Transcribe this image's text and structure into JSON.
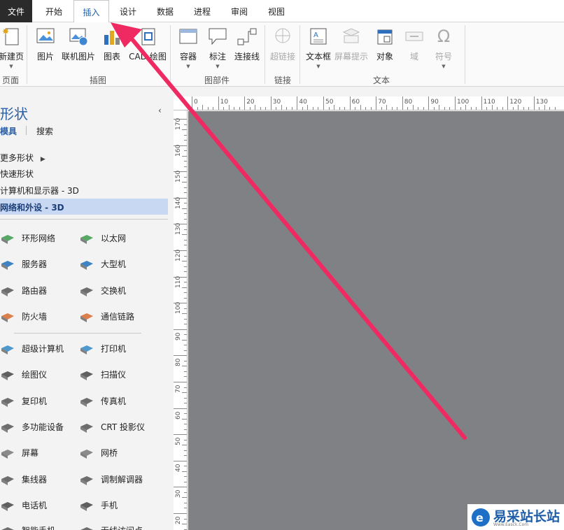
{
  "tabs": {
    "file": "文件",
    "home": "开始",
    "insert": "插入",
    "design": "设计",
    "data": "数据",
    "process": "进程",
    "review": "审阅",
    "view": "视图"
  },
  "ribbon": {
    "new_page": "新建页",
    "picture": "图片",
    "online_picture": "联机图片",
    "chart": "图表",
    "cad_drawing": "CAD 绘图",
    "container": "容器",
    "callout": "标注",
    "connector": "连接线",
    "hyperlink": "超链接",
    "screentip": "屏幕提示",
    "textbox": "文本框",
    "object": "对象",
    "field": "域",
    "symbol": "符号",
    "groups": {
      "pages": "页面",
      "illustrations": "插图",
      "diagram_parts": "图部件",
      "links": "链接",
      "text": "文本"
    }
  },
  "panel": {
    "title": "形状",
    "tab_stencils": "模具",
    "tab_search": "搜索",
    "more_shapes": "更多形状",
    "quick_shapes": "快速形状",
    "computers": "计算机和显示器 - 3D",
    "network": "网络和外设 - 3D"
  },
  "shapes": [
    {
      "left": "环形网络",
      "right": "以太网"
    },
    {
      "left": "服务器",
      "right": "大型机"
    },
    {
      "left": "路由器",
      "right": "交换机"
    },
    {
      "left": "防火墙",
      "right": "通信链路"
    },
    {
      "left": "超级计算机",
      "right": "打印机"
    },
    {
      "left": "绘图仪",
      "right": "扫描仪"
    },
    {
      "left": "复印机",
      "right": "传真机"
    },
    {
      "left": "多功能设备",
      "right": "CRT 投影仪"
    },
    {
      "left": "屏幕",
      "right": "网桥"
    },
    {
      "left": "集线器",
      "right": "调制解调器"
    },
    {
      "left": "电话机",
      "right": "手机"
    },
    {
      "left": "智能手机",
      "right": "无线访问点"
    }
  ],
  "ruler": {
    "h": [
      "0",
      "10",
      "20",
      "30",
      "40",
      "50",
      "60",
      "70",
      "80",
      "90",
      "100",
      "110",
      "120",
      "130"
    ],
    "v": [
      "170",
      "160",
      "150",
      "140",
      "130",
      "120",
      "110",
      "100",
      "90",
      "80",
      "70",
      "60",
      "50",
      "40",
      "30",
      "20"
    ]
  },
  "watermark": {
    "text": "易采站长站",
    "sub": "Www.Easck.Com"
  },
  "colors": {
    "accent": "#1a5ea8",
    "arrow": "#ef2a62",
    "canvas": "#808184",
    "selected_row": "#c8d7f2"
  }
}
